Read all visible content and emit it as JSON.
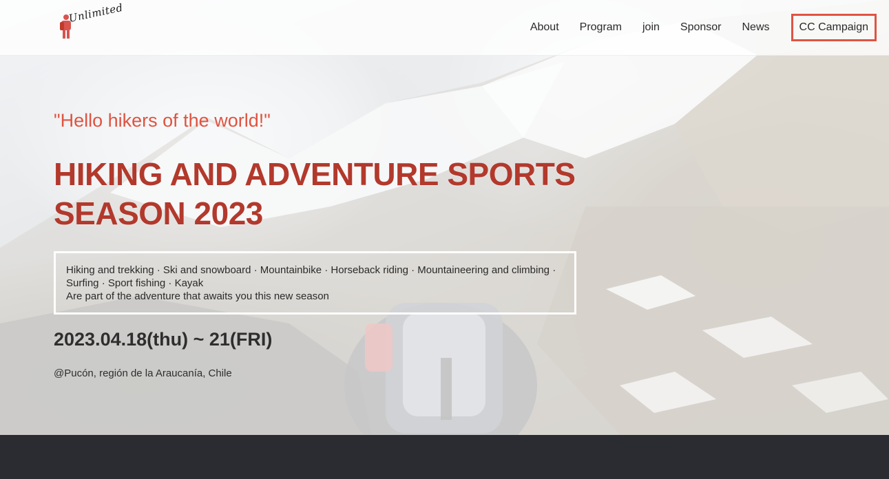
{
  "header": {
    "logo_text": "Unlimited",
    "nav": [
      "About",
      "Program",
      "join",
      "Sponsor",
      "News"
    ],
    "cta_label": "CC Campaign"
  },
  "hero": {
    "tagline": "\"Hello hikers of the world!\"",
    "headline_line1": "HIKING AND ADVENTURE SPORTS",
    "headline_line2": "SEASON 2023",
    "activities_line1": "Hiking and trekking · Ski and snowboard · Mountainbike · Horseback riding · Mountaineering and climbing · Surfing · Sport fishing · Kayak",
    "activities_line2": "Are part of the adventure that awaits you this new season",
    "dates": "2023.04.18(thu) ~ 21(FRI)",
    "location": "@Pucón, región de la Araucanía, Chile"
  },
  "colors": {
    "accent": "#e05340",
    "headline": "#b2392c",
    "footer": "#2a2c31"
  },
  "icons": {
    "logo": "hiker-logo-icon"
  }
}
